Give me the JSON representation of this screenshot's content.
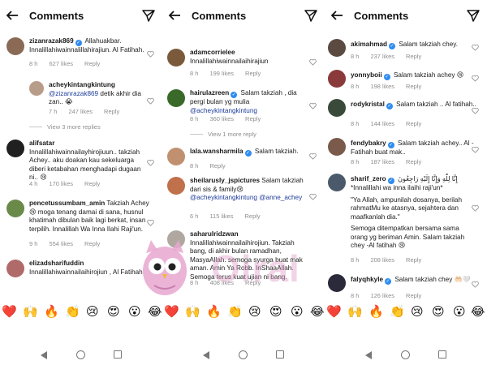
{
  "header": {
    "title": "Comments"
  },
  "panels": [
    {
      "comments": [
        {
          "user": "zizanrazak869",
          "verified": true,
          "text": "Allahuakbar. Innalillahiwainnalillahirajiun. Al Fatihah.",
          "time": "8 h",
          "likes": "627 likes",
          "reply": "Reply",
          "avatar_color": "#8a6a55"
        },
        {
          "user": "acheykintangkintung",
          "mention": "@zizanrazak869",
          "text": "detik akhir dia zan.. 😭",
          "time": "7 h",
          "likes": "247 likes",
          "reply": "Reply",
          "avatar_color": "#b89c8a",
          "view_replies": "View 3 more replies"
        },
        {
          "user": "alifsatar",
          "text": "Innalillahiwainnailayhirojiuun.. takziah Achey.. aku doakan kau sekeluarga diberi ketabahan menghadapi dugaan ni.. 😢",
          "time": "4 h",
          "likes": "170 likes",
          "reply": "Reply",
          "avatar_color": "#202020"
        },
        {
          "user": "pencetussumbam_amin",
          "text": "Takziah Achey 😢 moga tenang damai di sana, husnul khatimah dibulan baik lagi berkat, insan terpilih. Innalillah Wa Inna Ilahi Raji'un.",
          "time": "9 h",
          "likes": "554 likes",
          "reply": "Reply",
          "avatar_color": "#6a8a4a"
        },
        {
          "user": "elizadsharifuddin",
          "text": "Innalillahiwainnailaihirojiun , Al Fatihah",
          "time": "",
          "likes": "",
          "reply": "",
          "avatar_color": "#b06a6a"
        }
      ]
    },
    {
      "comments": [
        {
          "user": "adamcorrielee",
          "text": "Innalillahiwainnailaihirajiun",
          "time": "8 h",
          "likes": "199 likes",
          "reply": "Reply",
          "avatar_color": "#7a5a3a"
        },
        {
          "user": "hairulazreen",
          "verified": true,
          "text": "Salam takziah , dia pergi bulan yg mulia",
          "mention": "@acheykintangkintung",
          "time": "8 h",
          "likes": "360 likes",
          "reply": "Reply",
          "avatar_color": "#3a6a2a",
          "view_replies": "View 1 more reply"
        },
        {
          "user": "lala.wansharmila",
          "verified": true,
          "text": "Salam takziah.",
          "time": "8 h",
          "likes": "",
          "reply": "Reply",
          "avatar_color": "#c09070"
        },
        {
          "user": "sheilarusly_jspictures",
          "text": "Salam takziah dari sis & family😢",
          "mention": "@acheykintangkintung @anne_achey",
          "time": "6 h",
          "likes": "115 likes",
          "reply": "Reply",
          "avatar_color": "#c0704a"
        },
        {
          "user": "saharulridzwan",
          "text": "Innalillahiwainnailaihirojiun. Takziah bang, di akhir bulan ramadhan, MasyaAllah. semoga syurga buat mak aman. Amin Ya Robb. InShaaAllah. Semoga terus kuat ujian ni bang.",
          "time": "8 h",
          "likes": "408 likes",
          "reply": "Reply",
          "avatar_color": "#b0a8a0"
        }
      ]
    },
    {
      "comments": [
        {
          "user": "akimahmad",
          "verified": true,
          "text": "Salam takziah chey.",
          "time": "8 h",
          "likes": "237 likes",
          "reply": "Reply",
          "avatar_color": "#5a4a40"
        },
        {
          "user": "yonnyboii",
          "verified": true,
          "text": "Salam takziah achey 😢",
          "time": "8 h",
          "likes": "198 likes",
          "reply": "Reply",
          "avatar_color": "#8a3a3a"
        },
        {
          "user": "rodykristal",
          "verified": true,
          "text": "Salam takziah .. Al fatihah..",
          "time": "8 h",
          "likes": "144 likes",
          "reply": "Reply",
          "avatar_color": "#3a4a3a"
        },
        {
          "user": "fendybakry",
          "verified": true,
          "text": "Salam takziah achey.. Al - Fatihah buat mak..",
          "time": "8 h",
          "likes": "187 likes",
          "reply": "Reply",
          "avatar_color": "#7a5a4a"
        },
        {
          "user": "sharif_zero",
          "verified": true,
          "text_lines": [
            "إِنَّا لِلّٰهِ وَإِنَّا إِلَيْهِ رَاجِعُونَ",
            "*Innalillahi wa inna ilaihi raji'un*",
            "\"Ya Allah, ampunilah dosanya, berilah rahmatMu ke atasnya, sejahtera dan maafkanlah dia.\"",
            "Semoga ditempatkan bersama sama orang yg beriman  Amin. Salam takziah chey -Al fatihah 😢"
          ],
          "time": "8 h",
          "likes": "208 likes",
          "reply": "Reply",
          "avatar_color": "#4a5a6a"
        },
        {
          "user": "falyqhkyle",
          "verified": true,
          "text": "Salam takziah chey 🤲🏻🤍",
          "time": "8 h",
          "likes": "126 likes",
          "reply": "Reply",
          "avatar_color": "#2a2a3a"
        }
      ]
    }
  ],
  "emoji_bar": [
    "❤️",
    "🙌",
    "🔥",
    "👏",
    "😢",
    "😍",
    "😮",
    "😂"
  ],
  "watermark": {
    "text": "Oirai"
  }
}
